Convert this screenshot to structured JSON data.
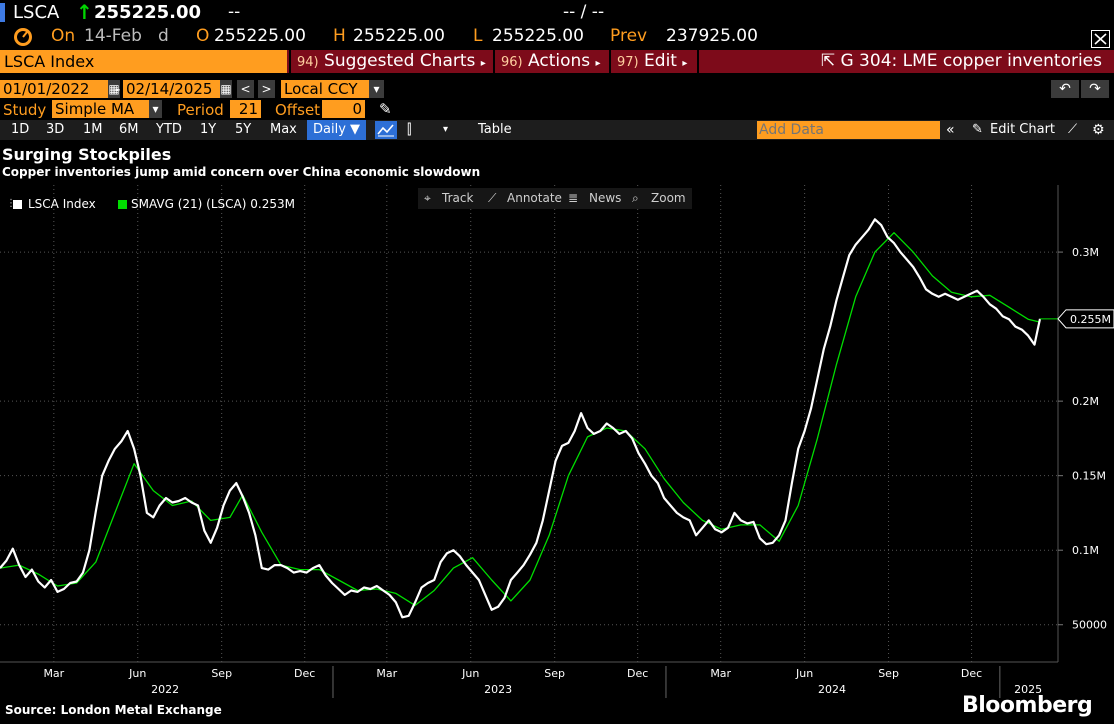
{
  "header": {
    "ticker": "LSCA",
    "last_price": "255225.00",
    "change_placeholder": "--",
    "time_placeholder": "-- / --",
    "on_label": "On",
    "date": "14-Feb",
    "date_suffix": "d",
    "open_label": "O",
    "open": "255225.00",
    "high_label": "H",
    "high": "255225.00",
    "low_label": "L",
    "low": "255225.00",
    "prev_label": "Prev",
    "prev": "237925.00"
  },
  "menubar": {
    "security": "LSCA Index",
    "suggested_num": "94)",
    "suggested": "Suggested Charts",
    "actions_num": "96)",
    "actions": "Actions",
    "edit_num": "97)",
    "edit": "Edit",
    "related": "G 304: LME copper inventories"
  },
  "range": {
    "start": "01/01/2022",
    "end": "02/14/2025",
    "currency": "Local CCY"
  },
  "study": {
    "study_label": "Study",
    "study_value": "Simple MA",
    "period_label": "Period",
    "period_value": "21",
    "offset_label": "Offset",
    "offset_value": "0"
  },
  "toolbar": {
    "periods": [
      "1D",
      "3D",
      "1M",
      "6M",
      "YTD",
      "1Y",
      "5Y",
      "Max"
    ],
    "frequency": "Daily ▼",
    "table": "Table",
    "add_data_placeholder": "Add Data",
    "edit_chart": "Edit Chart"
  },
  "chart_tools": {
    "track": "Track",
    "annotate": "Annotate",
    "news": "News",
    "zoom": "Zoom"
  },
  "titles": {
    "title": "Surging Stockpiles",
    "subtitle": "Copper inventories jump amid concern over China economic slowdown"
  },
  "legend": {
    "series1": "LSCA Index",
    "series2": "SMAVG (21) (LSCA) 0.253M"
  },
  "footer": {
    "source": "Source: London Metal Exchange",
    "brand": "Bloomberg"
  },
  "colors": {
    "orange": "#ff9d1f",
    "menu_red": "#7d0b1a",
    "series_white": "#ffffff",
    "series_green": "#00dd00"
  },
  "chart_data": {
    "type": "line",
    "y_ticks": [
      {
        "v": 50000,
        "label": "50000"
      },
      {
        "v": 100000,
        "label": "0.1M"
      },
      {
        "v": 150000,
        "label": "0.15M"
      },
      {
        "v": 200000,
        "label": "0.2M"
      },
      {
        "v": 300000,
        "label": "0.3M"
      }
    ],
    "ylim": [
      25000,
      345000
    ],
    "x_start": "2022-01-01",
    "x_end": "2025-02-14",
    "month_labels": [
      {
        "date": "2022-03-01",
        "label": "Mar"
      },
      {
        "date": "2022-06-01",
        "label": "Jun"
      },
      {
        "date": "2022-09-01",
        "label": "Sep"
      },
      {
        "date": "2022-12-01",
        "label": "Dec"
      },
      {
        "date": "2023-03-01",
        "label": "Mar"
      },
      {
        "date": "2023-06-01",
        "label": "Jun"
      },
      {
        "date": "2023-09-01",
        "label": "Sep"
      },
      {
        "date": "2023-12-01",
        "label": "Dec"
      },
      {
        "date": "2024-03-01",
        "label": "Mar"
      },
      {
        "date": "2024-06-01",
        "label": "Jun"
      },
      {
        "date": "2024-09-01",
        "label": "Sep"
      },
      {
        "date": "2024-12-01",
        "label": "Dec"
      }
    ],
    "year_labels": [
      {
        "date": "2022-07-01",
        "label": "2022"
      },
      {
        "date": "2023-07-01",
        "label": "2023"
      },
      {
        "date": "2024-07-01",
        "label": "2024"
      },
      {
        "date": "2025-02-01",
        "label": "2025"
      }
    ],
    "last_value_label": "0.255M",
    "series": [
      {
        "name": "LSCA Index",
        "color": "#ffffff",
        "points": [
          [
            "2022-01-01",
            88000
          ],
          [
            "2022-01-08",
            93000
          ],
          [
            "2022-01-15",
            101000
          ],
          [
            "2022-01-22",
            90000
          ],
          [
            "2022-01-29",
            82000
          ],
          [
            "2022-02-05",
            87000
          ],
          [
            "2022-02-12",
            79000
          ],
          [
            "2022-02-19",
            75000
          ],
          [
            "2022-02-26",
            80000
          ],
          [
            "2022-03-05",
            72000
          ],
          [
            "2022-03-12",
            74000
          ],
          [
            "2022-03-19",
            78000
          ],
          [
            "2022-03-26",
            79000
          ],
          [
            "2022-04-02",
            85000
          ],
          [
            "2022-04-09",
            100000
          ],
          [
            "2022-04-16",
            126000
          ],
          [
            "2022-04-23",
            150000
          ],
          [
            "2022-04-30",
            160000
          ],
          [
            "2022-05-07",
            168000
          ],
          [
            "2022-05-14",
            173000
          ],
          [
            "2022-05-21",
            180000
          ],
          [
            "2022-05-28",
            168000
          ],
          [
            "2022-06-04",
            150000
          ],
          [
            "2022-06-11",
            125000
          ],
          [
            "2022-06-18",
            122000
          ],
          [
            "2022-06-25",
            130000
          ],
          [
            "2022-07-02",
            135000
          ],
          [
            "2022-07-09",
            132000
          ],
          [
            "2022-07-16",
            133000
          ],
          [
            "2022-07-23",
            135000
          ],
          [
            "2022-07-30",
            132000
          ],
          [
            "2022-08-06",
            130000
          ],
          [
            "2022-08-13",
            113000
          ],
          [
            "2022-08-20",
            105000
          ],
          [
            "2022-08-27",
            115000
          ],
          [
            "2022-09-03",
            130000
          ],
          [
            "2022-09-10",
            140000
          ],
          [
            "2022-09-17",
            145000
          ],
          [
            "2022-09-24",
            136000
          ],
          [
            "2022-10-01",
            125000
          ],
          [
            "2022-10-08",
            110000
          ],
          [
            "2022-10-15",
            88000
          ],
          [
            "2022-10-22",
            87000
          ],
          [
            "2022-10-29",
            90000
          ],
          [
            "2022-11-05",
            90000
          ],
          [
            "2022-11-12",
            88000
          ],
          [
            "2022-11-19",
            85000
          ],
          [
            "2022-11-26",
            86000
          ],
          [
            "2022-12-03",
            85000
          ],
          [
            "2022-12-10",
            88000
          ],
          [
            "2022-12-17",
            90000
          ],
          [
            "2022-12-24",
            83000
          ],
          [
            "2022-12-31",
            78000
          ],
          [
            "2023-01-07",
            74000
          ],
          [
            "2023-01-14",
            70000
          ],
          [
            "2023-01-21",
            73000
          ],
          [
            "2023-01-28",
            72000
          ],
          [
            "2023-02-04",
            75000
          ],
          [
            "2023-02-11",
            74000
          ],
          [
            "2023-02-18",
            76000
          ],
          [
            "2023-02-25",
            73000
          ],
          [
            "2023-03-04",
            70000
          ],
          [
            "2023-03-11",
            65000
          ],
          [
            "2023-03-18",
            55000
          ],
          [
            "2023-03-25",
            56000
          ],
          [
            "2023-04-01",
            65000
          ],
          [
            "2023-04-08",
            75000
          ],
          [
            "2023-04-15",
            78000
          ],
          [
            "2023-04-22",
            80000
          ],
          [
            "2023-04-29",
            92000
          ],
          [
            "2023-05-06",
            98000
          ],
          [
            "2023-05-13",
            100000
          ],
          [
            "2023-05-20",
            96000
          ],
          [
            "2023-05-27",
            90000
          ],
          [
            "2023-06-03",
            85000
          ],
          [
            "2023-06-10",
            80000
          ],
          [
            "2023-06-17",
            70000
          ],
          [
            "2023-06-24",
            60000
          ],
          [
            "2023-07-01",
            62000
          ],
          [
            "2023-07-08",
            68000
          ],
          [
            "2023-07-15",
            80000
          ],
          [
            "2023-07-22",
            85000
          ],
          [
            "2023-07-29",
            90000
          ],
          [
            "2023-08-05",
            97000
          ],
          [
            "2023-08-12",
            105000
          ],
          [
            "2023-08-19",
            120000
          ],
          [
            "2023-08-26",
            140000
          ],
          [
            "2023-09-02",
            160000
          ],
          [
            "2023-09-09",
            170000
          ],
          [
            "2023-09-16",
            172000
          ],
          [
            "2023-09-23",
            180000
          ],
          [
            "2023-09-30",
            192000
          ],
          [
            "2023-10-07",
            182000
          ],
          [
            "2023-10-14",
            178000
          ],
          [
            "2023-10-21",
            180000
          ],
          [
            "2023-10-28",
            185000
          ],
          [
            "2023-11-04",
            182000
          ],
          [
            "2023-11-11",
            178000
          ],
          [
            "2023-11-18",
            180000
          ],
          [
            "2023-11-25",
            175000
          ],
          [
            "2023-12-02",
            165000
          ],
          [
            "2023-12-09",
            158000
          ],
          [
            "2023-12-16",
            150000
          ],
          [
            "2023-12-23",
            145000
          ],
          [
            "2023-12-30",
            135000
          ],
          [
            "2024-01-06",
            130000
          ],
          [
            "2024-01-13",
            125000
          ],
          [
            "2024-01-20",
            122000
          ],
          [
            "2024-01-27",
            120000
          ],
          [
            "2024-02-03",
            110000
          ],
          [
            "2024-02-10",
            115000
          ],
          [
            "2024-02-17",
            120000
          ],
          [
            "2024-02-24",
            114000
          ],
          [
            "2024-03-02",
            112000
          ],
          [
            "2024-03-09",
            115000
          ],
          [
            "2024-03-16",
            125000
          ],
          [
            "2024-03-23",
            120000
          ],
          [
            "2024-03-30",
            118000
          ],
          [
            "2024-04-06",
            119000
          ],
          [
            "2024-04-13",
            108000
          ],
          [
            "2024-04-20",
            104000
          ],
          [
            "2024-04-27",
            105000
          ],
          [
            "2024-05-04",
            110000
          ],
          [
            "2024-05-11",
            120000
          ],
          [
            "2024-05-18",
            145000
          ],
          [
            "2024-05-25",
            168000
          ],
          [
            "2024-06-01",
            180000
          ],
          [
            "2024-06-08",
            195000
          ],
          [
            "2024-06-15",
            215000
          ],
          [
            "2024-06-22",
            235000
          ],
          [
            "2024-06-29",
            250000
          ],
          [
            "2024-07-06",
            268000
          ],
          [
            "2024-07-13",
            283000
          ],
          [
            "2024-07-20",
            298000
          ],
          [
            "2024-07-27",
            305000
          ],
          [
            "2024-08-03",
            310000
          ],
          [
            "2024-08-10",
            315000
          ],
          [
            "2024-08-17",
            322000
          ],
          [
            "2024-08-24",
            318000
          ],
          [
            "2024-08-31",
            310000
          ],
          [
            "2024-09-07",
            306000
          ],
          [
            "2024-09-14",
            300000
          ],
          [
            "2024-09-21",
            295000
          ],
          [
            "2024-09-28",
            290000
          ],
          [
            "2024-10-05",
            283000
          ],
          [
            "2024-10-12",
            275000
          ],
          [
            "2024-10-19",
            272000
          ],
          [
            "2024-10-26",
            270000
          ],
          [
            "2024-11-02",
            272000
          ],
          [
            "2024-11-09",
            270000
          ],
          [
            "2024-11-16",
            268000
          ],
          [
            "2024-11-23",
            270000
          ],
          [
            "2024-11-30",
            272000
          ],
          [
            "2024-12-07",
            274000
          ],
          [
            "2024-12-14",
            270000
          ],
          [
            "2024-12-21",
            265000
          ],
          [
            "2024-12-28",
            262000
          ],
          [
            "2025-01-04",
            257000
          ],
          [
            "2025-01-11",
            255000
          ],
          [
            "2025-01-18",
            250000
          ],
          [
            "2025-01-25",
            248000
          ],
          [
            "2025-02-01",
            244000
          ],
          [
            "2025-02-08",
            237925
          ],
          [
            "2025-02-14",
            255225
          ]
        ]
      },
      {
        "name": "SMAVG (21) (LSCA)",
        "color": "#00dd00",
        "points": [
          [
            "2022-01-01",
            88000
          ],
          [
            "2022-01-22",
            90000
          ],
          [
            "2022-02-12",
            84000
          ],
          [
            "2022-03-05",
            76000
          ],
          [
            "2022-03-26",
            78000
          ],
          [
            "2022-04-16",
            92000
          ],
          [
            "2022-05-07",
            125000
          ],
          [
            "2022-05-28",
            158000
          ],
          [
            "2022-06-18",
            140000
          ],
          [
            "2022-07-09",
            130000
          ],
          [
            "2022-07-30",
            133000
          ],
          [
            "2022-08-20",
            120000
          ],
          [
            "2022-09-10",
            122000
          ],
          [
            "2022-09-24",
            137000
          ],
          [
            "2022-10-15",
            112000
          ],
          [
            "2022-11-05",
            90000
          ],
          [
            "2022-11-26",
            87000
          ],
          [
            "2022-12-17",
            87000
          ],
          [
            "2023-01-07",
            80000
          ],
          [
            "2023-01-28",
            73000
          ],
          [
            "2023-02-18",
            74000
          ],
          [
            "2023-03-11",
            71000
          ],
          [
            "2023-04-01",
            63000
          ],
          [
            "2023-04-22",
            73000
          ],
          [
            "2023-05-13",
            88000
          ],
          [
            "2023-06-03",
            95000
          ],
          [
            "2023-06-24",
            80000
          ],
          [
            "2023-07-15",
            66000
          ],
          [
            "2023-08-05",
            80000
          ],
          [
            "2023-08-26",
            110000
          ],
          [
            "2023-09-16",
            150000
          ],
          [
            "2023-10-07",
            176000
          ],
          [
            "2023-10-28",
            182000
          ],
          [
            "2023-11-18",
            180000
          ],
          [
            "2023-12-09",
            168000
          ],
          [
            "2023-12-30",
            148000
          ],
          [
            "2024-01-20",
            132000
          ],
          [
            "2024-02-10",
            120000
          ],
          [
            "2024-03-02",
            114000
          ],
          [
            "2024-03-23",
            117000
          ],
          [
            "2024-04-13",
            117000
          ],
          [
            "2024-05-04",
            106000
          ],
          [
            "2024-05-25",
            130000
          ],
          [
            "2024-06-15",
            175000
          ],
          [
            "2024-07-06",
            225000
          ],
          [
            "2024-07-27",
            270000
          ],
          [
            "2024-08-17",
            300000
          ],
          [
            "2024-09-07",
            313000
          ],
          [
            "2024-09-28",
            300000
          ],
          [
            "2024-10-19",
            284000
          ],
          [
            "2024-11-09",
            273000
          ],
          [
            "2024-11-30",
            270000
          ],
          [
            "2024-12-21",
            271000
          ],
          [
            "2025-01-11",
            263000
          ],
          [
            "2025-02-01",
            255000
          ],
          [
            "2025-02-14",
            253000
          ]
        ]
      }
    ]
  }
}
